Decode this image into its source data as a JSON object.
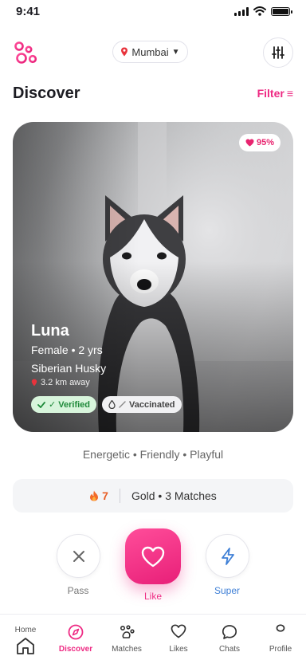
{
  "status_bar": {
    "time": "9:41"
  },
  "top_bar": {
    "location": "Mumbai",
    "location_caret": "▼"
  },
  "header": {
    "title": "Discover",
    "filter_label": "Filter",
    "filter_glyph": "≡"
  },
  "card": {
    "match_percent": "95%",
    "name": "Luna",
    "meta": "Female • 2 yrs",
    "breed": "Siberian Husky",
    "distance": "3.2 km away",
    "tags": {
      "verified": "✓ Verified",
      "vaccinated": "Vaccinated"
    }
  },
  "traits": "Energetic • Friendly • Playful",
  "stats": {
    "streak": "7",
    "summary": "Gold • 3 Matches"
  },
  "actions": {
    "pass": "Pass",
    "like": "Like",
    "super": "Super"
  },
  "nav": {
    "home": "Home",
    "discover": "Discover",
    "matches": "Matches",
    "likes": "Likes",
    "chats": "Chats",
    "profile": "Profile"
  },
  "colors": {
    "accent": "#ee2a83",
    "super": "#3e7fd6",
    "verified": "#1f8a3a",
    "streak": "#e85d25"
  }
}
